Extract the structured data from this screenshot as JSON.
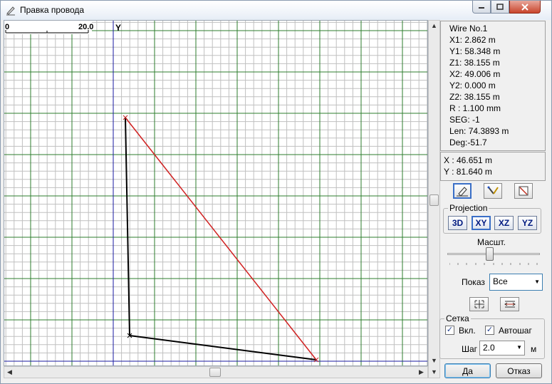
{
  "window": {
    "title": "Правка провода"
  },
  "scale_bar": {
    "start": "0",
    "end": "20.0"
  },
  "axis": {
    "y_label": "Y"
  },
  "wire_info": [
    "Wire No.1",
    "X1: 2.862 m",
    "Y1: 58.348 m",
    "Z1: 38.155 m",
    "X2: 49.006 m",
    "Y2: 0.000 m",
    "Z2: 38.155 m",
    "R  : 1.100 mm",
    "SEG: -1",
    "Len: 74.3893 m",
    "Deg:-51.7"
  ],
  "cursor": {
    "x": "X : 46.651 m",
    "y": "Y : 81.640 m"
  },
  "projection": {
    "legend": "Projection",
    "buttons": [
      "3D",
      "XY",
      "XZ",
      "YZ"
    ]
  },
  "zoom": {
    "label": "Масшт.",
    "level": 0.45
  },
  "show": {
    "label": "Показ",
    "value": "Все"
  },
  "grid": {
    "legend": "Сетка",
    "enabled_label": "Вкл.",
    "enabled": true,
    "autostep_label": "Автошаг",
    "autostep": true,
    "step_label": "Шаг",
    "step_value": "2.0",
    "unit": "м"
  },
  "buttons": {
    "ok": "Да",
    "cancel": "Отказ"
  },
  "colors": {
    "grid_minor": "#c0c0c0",
    "grid_major": "#2e7d2e",
    "axis": "#1a1aa0",
    "wire_selected": "#d02020",
    "wire": "#000000"
  },
  "icons": {
    "title": "pen-icon",
    "tools": [
      "pen-icon",
      "wand-icon",
      "delete-wire-icon"
    ],
    "view": [
      "fit-all-icon",
      "fit-width-icon"
    ]
  }
}
